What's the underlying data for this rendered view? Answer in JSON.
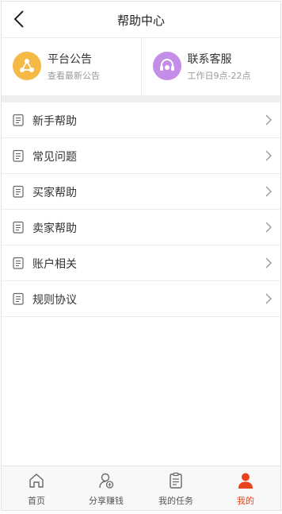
{
  "header": {
    "title": "帮助中心"
  },
  "cards": [
    {
      "title": "平台公告",
      "subtitle": "查看最新公告",
      "icon": "share-nodes-icon",
      "color": "#f5b945"
    },
    {
      "title": "联系客服",
      "subtitle": "工作日9点-22点",
      "icon": "headset-icon",
      "color": "#c48de8"
    }
  ],
  "menu": {
    "items": [
      {
        "label": "新手帮助"
      },
      {
        "label": "常见问题"
      },
      {
        "label": "买家帮助"
      },
      {
        "label": "卖家帮助"
      },
      {
        "label": "账户相关"
      },
      {
        "label": "规则协议"
      }
    ]
  },
  "tabbar": {
    "tabs": [
      {
        "label": "首页",
        "icon": "home-icon"
      },
      {
        "label": "分享赚钱",
        "icon": "share-money-icon"
      },
      {
        "label": "我的任务",
        "icon": "task-list-icon"
      },
      {
        "label": "我的",
        "icon": "user-icon",
        "active": true
      }
    ],
    "active_color": "#e8431f"
  }
}
